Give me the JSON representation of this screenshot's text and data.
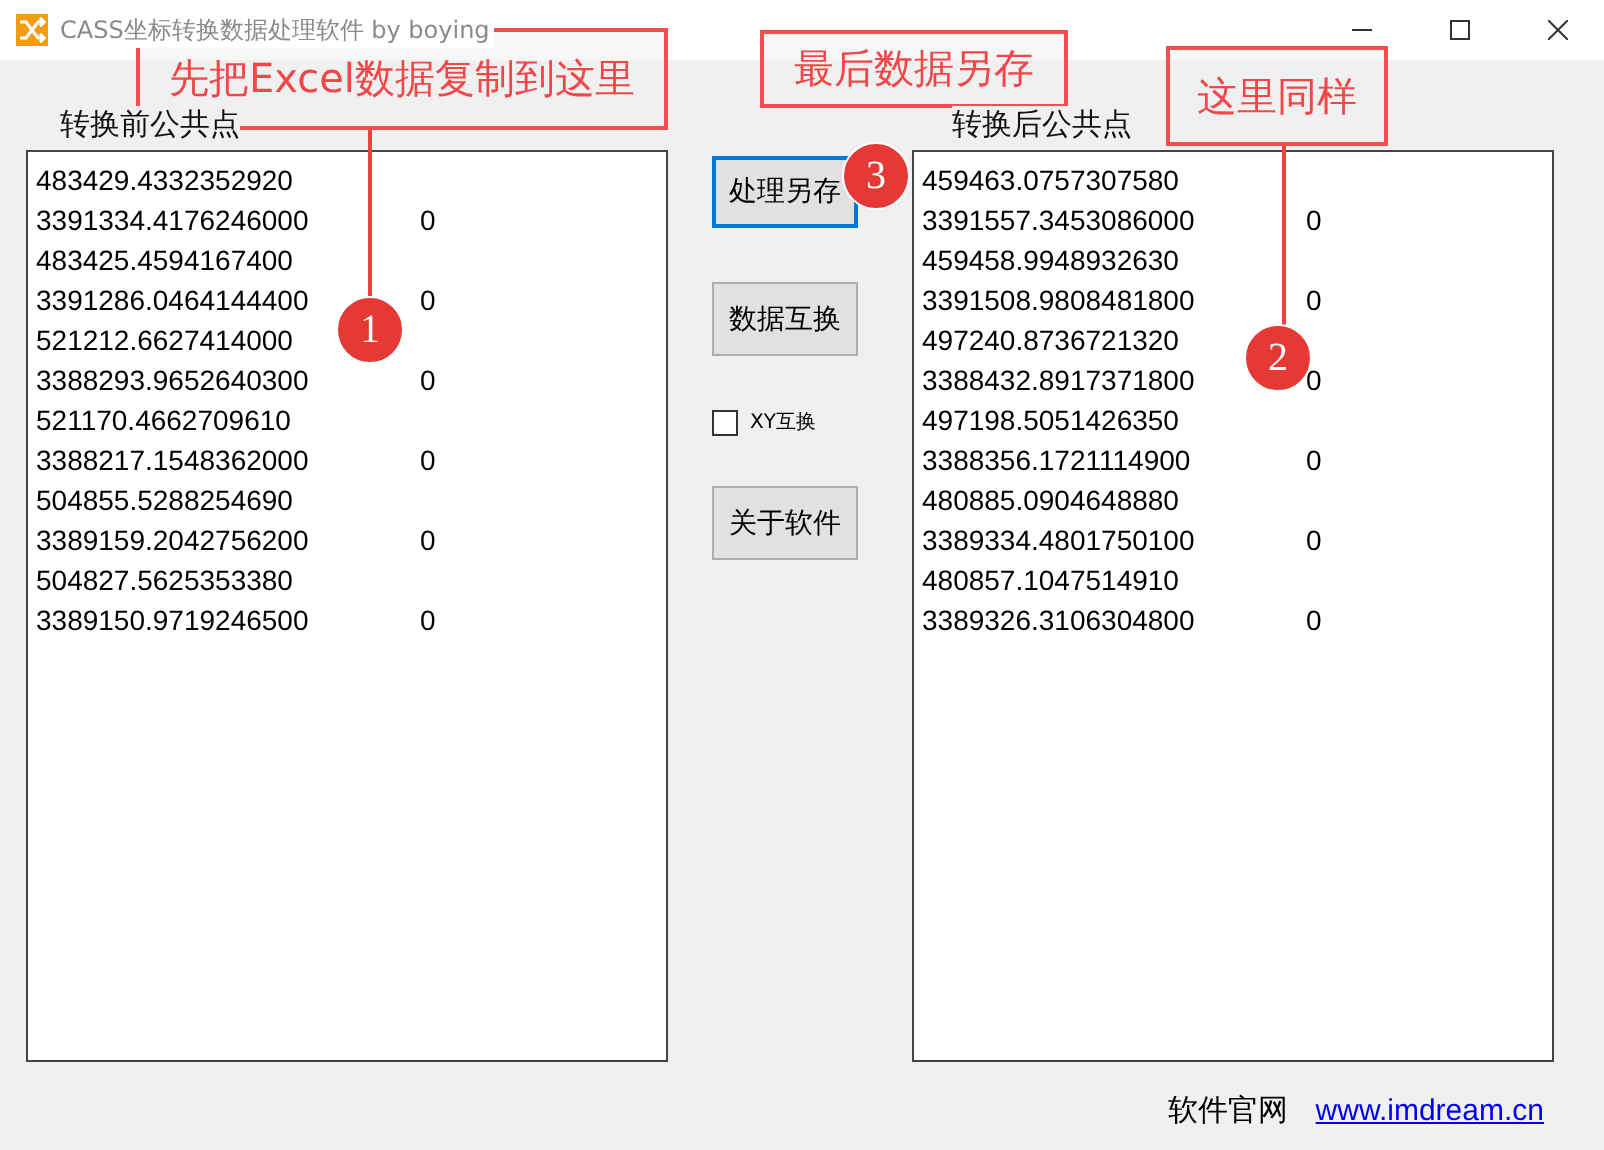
{
  "window": {
    "title": "CASS坐标转换数据处理软件 by boying"
  },
  "panels": [
    {
      "label": "转换前公共点",
      "lines": [
        {
          "text": "483429.4332352920"
        },
        {
          "text": "3391334.4176246000",
          "col2": "0"
        },
        {
          "text": "483425.4594167400"
        },
        {
          "text": "3391286.0464144400",
          "col2": "0"
        },
        {
          "text": "521212.6627414000"
        },
        {
          "text": "3388293.9652640300",
          "col2": "0"
        },
        {
          "text": "521170.4662709610"
        },
        {
          "text": "3388217.1548362000",
          "col2": "0"
        },
        {
          "text": "504855.5288254690"
        },
        {
          "text": "3389159.2042756200",
          "col2": "0"
        },
        {
          "text": "504827.5625353380"
        },
        {
          "text": "3389150.9719246500",
          "col2": "0"
        }
      ]
    },
    {
      "label": "转换后公共点",
      "lines": [
        {
          "text": "459463.0757307580"
        },
        {
          "text": "3391557.3453086000",
          "col2": "0"
        },
        {
          "text": "459458.9948932630"
        },
        {
          "text": "3391508.9808481800",
          "col2": "0"
        },
        {
          "text": "497240.8736721320"
        },
        {
          "text": "3388432.8917371800",
          "col2": "0"
        },
        {
          "text": "497198.5051426350"
        },
        {
          "text": "3388356.1721114900",
          "col2": "0"
        },
        {
          "text": "480885.0904648880"
        },
        {
          "text": "3389334.4801750100",
          "col2": "0"
        },
        {
          "text": "480857.1047514910"
        },
        {
          "text": "3389326.3106304800",
          "col2": "0"
        }
      ]
    }
  ],
  "controls": [
    {
      "kind": "button",
      "label": "处理另存",
      "focused": true
    },
    {
      "kind": "button",
      "label": "数据互换",
      "focused": false
    },
    {
      "kind": "checkbox",
      "label": "XY互换",
      "checked": false
    },
    {
      "kind": "button",
      "label": "关于软件",
      "focused": false
    }
  ],
  "footer": {
    "label": "软件官网",
    "link": "www.imdream.cn"
  },
  "callouts": [
    {
      "text": "先把Excel数据复制到这里",
      "number": "1"
    },
    {
      "text": "最后数据另存",
      "number": "3"
    },
    {
      "text": "这里同样",
      "number": "2"
    }
  ]
}
